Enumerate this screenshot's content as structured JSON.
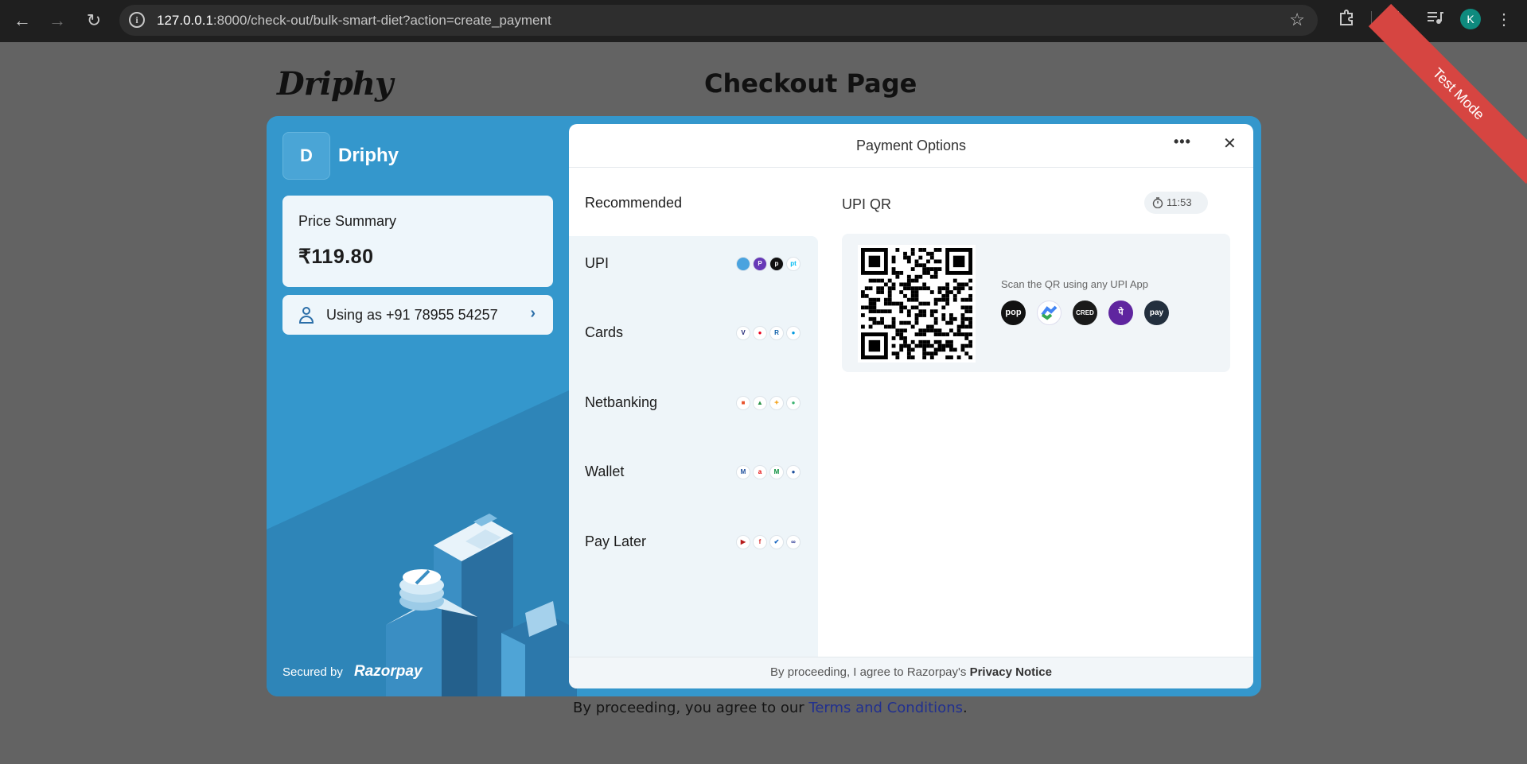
{
  "browser": {
    "url_host": "127.0.0.1",
    "url_rest": ":8000/check-out/bulk-smart-diet?action=create_payment",
    "profile_initial": "K"
  },
  "page": {
    "logo": "Driphy",
    "title": "Checkout Page",
    "terms_prefix": "By proceeding, you agree to our ",
    "terms_link": "Terms and Conditions",
    "terms_suffix": "."
  },
  "ribbon": {
    "label": "Test Mode"
  },
  "checkout": {
    "merchant_initial": "D",
    "merchant_name": "Driphy",
    "price_label": "Price Summary",
    "price_amount": "₹119.80",
    "contact_text": "Using as +91 78955 54257",
    "secured_label": "Secured by",
    "secured_brand": "Razorpay",
    "header_title": "Payment Options",
    "recommended_label": "Recommended",
    "methods": [
      {
        "label": "UPI",
        "icons": [
          "upi-app-1",
          "phonepe",
          "pop",
          "paytm"
        ]
      },
      {
        "label": "Cards",
        "icons": [
          "visa",
          "mastercard",
          "rupay",
          "maestro"
        ]
      },
      {
        "label": "Netbanking",
        "icons": [
          "bank-1",
          "bank-2",
          "bank-3",
          "bank-4"
        ]
      },
      {
        "label": "Wallet",
        "icons": [
          "wallet-1",
          "airtel",
          "mobikwik",
          "wallet-4"
        ]
      },
      {
        "label": "Pay Later",
        "icons": [
          "paylater-1",
          "paylater-2",
          "paylater-3",
          "paylater-4"
        ]
      }
    ],
    "upi_title": "UPI QR",
    "timer": "11:53",
    "qr_hint": "Scan the QR using any UPI App",
    "apps": [
      {
        "name": "pop",
        "color": "#111111"
      },
      {
        "name": "gpay",
        "color": "#4285f4"
      },
      {
        "name": "cred",
        "color": "#1a1a1a"
      },
      {
        "name": "phonepe",
        "color": "#5f259f"
      },
      {
        "name": "amazon-pay",
        "color": "#232f3e"
      }
    ],
    "footer_prefix": "By proceeding, I agree to Razorpay's ",
    "footer_link": "Privacy Notice"
  }
}
